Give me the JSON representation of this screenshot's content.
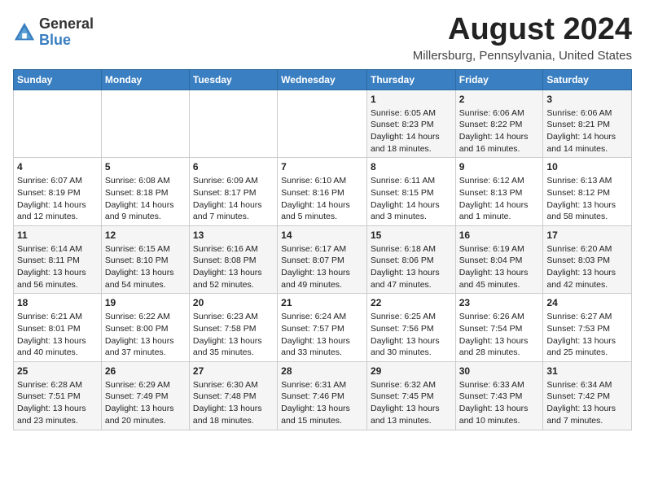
{
  "logo": {
    "general": "General",
    "blue": "Blue"
  },
  "header": {
    "month_year": "August 2024",
    "location": "Millersburg, Pennsylvania, United States"
  },
  "days_of_week": [
    "Sunday",
    "Monday",
    "Tuesday",
    "Wednesday",
    "Thursday",
    "Friday",
    "Saturday"
  ],
  "weeks": [
    [
      {
        "day": "",
        "content": ""
      },
      {
        "day": "",
        "content": ""
      },
      {
        "day": "",
        "content": ""
      },
      {
        "day": "",
        "content": ""
      },
      {
        "day": "1",
        "content": "Sunrise: 6:05 AM\nSunset: 8:23 PM\nDaylight: 14 hours\nand 18 minutes."
      },
      {
        "day": "2",
        "content": "Sunrise: 6:06 AM\nSunset: 8:22 PM\nDaylight: 14 hours\nand 16 minutes."
      },
      {
        "day": "3",
        "content": "Sunrise: 6:06 AM\nSunset: 8:21 PM\nDaylight: 14 hours\nand 14 minutes."
      }
    ],
    [
      {
        "day": "4",
        "content": "Sunrise: 6:07 AM\nSunset: 8:19 PM\nDaylight: 14 hours\nand 12 minutes."
      },
      {
        "day": "5",
        "content": "Sunrise: 6:08 AM\nSunset: 8:18 PM\nDaylight: 14 hours\nand 9 minutes."
      },
      {
        "day": "6",
        "content": "Sunrise: 6:09 AM\nSunset: 8:17 PM\nDaylight: 14 hours\nand 7 minutes."
      },
      {
        "day": "7",
        "content": "Sunrise: 6:10 AM\nSunset: 8:16 PM\nDaylight: 14 hours\nand 5 minutes."
      },
      {
        "day": "8",
        "content": "Sunrise: 6:11 AM\nSunset: 8:15 PM\nDaylight: 14 hours\nand 3 minutes."
      },
      {
        "day": "9",
        "content": "Sunrise: 6:12 AM\nSunset: 8:13 PM\nDaylight: 14 hours\nand 1 minute."
      },
      {
        "day": "10",
        "content": "Sunrise: 6:13 AM\nSunset: 8:12 PM\nDaylight: 13 hours\nand 58 minutes."
      }
    ],
    [
      {
        "day": "11",
        "content": "Sunrise: 6:14 AM\nSunset: 8:11 PM\nDaylight: 13 hours\nand 56 minutes."
      },
      {
        "day": "12",
        "content": "Sunrise: 6:15 AM\nSunset: 8:10 PM\nDaylight: 13 hours\nand 54 minutes."
      },
      {
        "day": "13",
        "content": "Sunrise: 6:16 AM\nSunset: 8:08 PM\nDaylight: 13 hours\nand 52 minutes."
      },
      {
        "day": "14",
        "content": "Sunrise: 6:17 AM\nSunset: 8:07 PM\nDaylight: 13 hours\nand 49 minutes."
      },
      {
        "day": "15",
        "content": "Sunrise: 6:18 AM\nSunset: 8:06 PM\nDaylight: 13 hours\nand 47 minutes."
      },
      {
        "day": "16",
        "content": "Sunrise: 6:19 AM\nSunset: 8:04 PM\nDaylight: 13 hours\nand 45 minutes."
      },
      {
        "day": "17",
        "content": "Sunrise: 6:20 AM\nSunset: 8:03 PM\nDaylight: 13 hours\nand 42 minutes."
      }
    ],
    [
      {
        "day": "18",
        "content": "Sunrise: 6:21 AM\nSunset: 8:01 PM\nDaylight: 13 hours\nand 40 minutes."
      },
      {
        "day": "19",
        "content": "Sunrise: 6:22 AM\nSunset: 8:00 PM\nDaylight: 13 hours\nand 37 minutes."
      },
      {
        "day": "20",
        "content": "Sunrise: 6:23 AM\nSunset: 7:58 PM\nDaylight: 13 hours\nand 35 minutes."
      },
      {
        "day": "21",
        "content": "Sunrise: 6:24 AM\nSunset: 7:57 PM\nDaylight: 13 hours\nand 33 minutes."
      },
      {
        "day": "22",
        "content": "Sunrise: 6:25 AM\nSunset: 7:56 PM\nDaylight: 13 hours\nand 30 minutes."
      },
      {
        "day": "23",
        "content": "Sunrise: 6:26 AM\nSunset: 7:54 PM\nDaylight: 13 hours\nand 28 minutes."
      },
      {
        "day": "24",
        "content": "Sunrise: 6:27 AM\nSunset: 7:53 PM\nDaylight: 13 hours\nand 25 minutes."
      }
    ],
    [
      {
        "day": "25",
        "content": "Sunrise: 6:28 AM\nSunset: 7:51 PM\nDaylight: 13 hours\nand 23 minutes."
      },
      {
        "day": "26",
        "content": "Sunrise: 6:29 AM\nSunset: 7:49 PM\nDaylight: 13 hours\nand 20 minutes."
      },
      {
        "day": "27",
        "content": "Sunrise: 6:30 AM\nSunset: 7:48 PM\nDaylight: 13 hours\nand 18 minutes."
      },
      {
        "day": "28",
        "content": "Sunrise: 6:31 AM\nSunset: 7:46 PM\nDaylight: 13 hours\nand 15 minutes."
      },
      {
        "day": "29",
        "content": "Sunrise: 6:32 AM\nSunset: 7:45 PM\nDaylight: 13 hours\nand 13 minutes."
      },
      {
        "day": "30",
        "content": "Sunrise: 6:33 AM\nSunset: 7:43 PM\nDaylight: 13 hours\nand 10 minutes."
      },
      {
        "day": "31",
        "content": "Sunrise: 6:34 AM\nSunset: 7:42 PM\nDaylight: 13 hours\nand 7 minutes."
      }
    ]
  ]
}
